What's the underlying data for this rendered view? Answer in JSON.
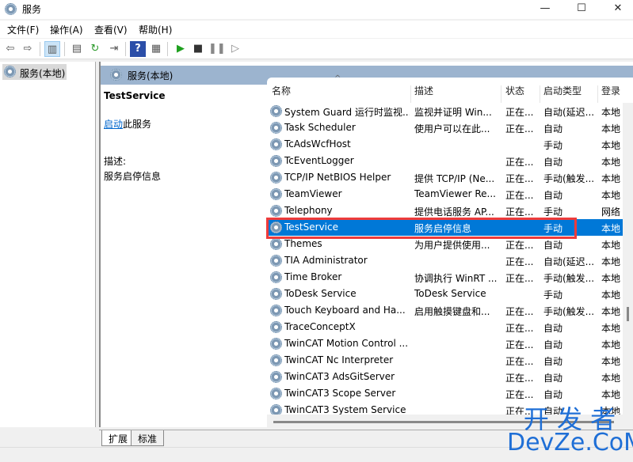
{
  "window": {
    "title": "服务",
    "min": "—",
    "max": "☐",
    "close": "✕"
  },
  "menu": [
    "文件(F)",
    "操作(A)",
    "查看(V)",
    "帮助(H)"
  ],
  "toolbar": [
    "back",
    "forward",
    "console-tree",
    "properties",
    "refresh",
    "export",
    "help",
    "action-pane",
    "start",
    "stop",
    "pause",
    "resume"
  ],
  "tree": {
    "item": "服务(本地)"
  },
  "band": {
    "title": "服务(本地)"
  },
  "details": {
    "name": "TestService",
    "link": "启动",
    "link_suffix": "此服务",
    "desc_label": "描述:",
    "desc": "服务启停信息"
  },
  "columns": [
    "名称",
    "描述",
    "状态",
    "启动类型",
    "登录"
  ],
  "rows": [
    [
      "System Guard 运行时监视...",
      "监视并证明 Win...",
      "正在...",
      "自动(延迟...",
      "本地"
    ],
    [
      "Task Scheduler",
      "使用户可以在此...",
      "正在...",
      "自动",
      "本地"
    ],
    [
      "TcAdsWcfHost",
      "",
      "",
      "手动",
      "本地"
    ],
    [
      "TcEventLogger",
      "",
      "正在...",
      "自动",
      "本地"
    ],
    [
      "TCP/IP NetBIOS Helper",
      "提供 TCP/IP (Ne...",
      "正在...",
      "手动(触发...",
      "本地"
    ],
    [
      "TeamViewer",
      "TeamViewer Re...",
      "正在...",
      "自动",
      "本地"
    ],
    [
      "Telephony",
      "提供电话服务 AP...",
      "正在...",
      "手动",
      "网络"
    ],
    [
      "TestService",
      "服务启停信息",
      "",
      "手动",
      "本地"
    ],
    [
      "Themes",
      "为用户提供使用...",
      "正在...",
      "自动",
      "本地"
    ],
    [
      "TIA Administrator",
      "",
      "正在...",
      "自动(延迟...",
      "本地"
    ],
    [
      "Time Broker",
      "协调执行 WinRT ...",
      "正在...",
      "手动(触发...",
      "本地"
    ],
    [
      "ToDesk Service",
      "ToDesk Service",
      "",
      "手动",
      "本地"
    ],
    [
      "Touch Keyboard and Ha...",
      "启用触摸键盘和...",
      "正在...",
      "手动(触发...",
      "本地"
    ],
    [
      "TraceConceptX",
      "",
      "正在...",
      "自动",
      "本地"
    ],
    [
      "TwinCAT Motion Control ...",
      "",
      "正在...",
      "自动",
      "本地"
    ],
    [
      "TwinCAT Nc Interpreter",
      "",
      "正在...",
      "自动",
      "本地"
    ],
    [
      "TwinCAT3 AdsGitServer",
      "",
      "正在...",
      "自动",
      "本地"
    ],
    [
      "TwinCAT3 Scope Server",
      "",
      "正在...",
      "自动",
      "本地"
    ],
    [
      "TwinCAT3 System Service",
      "",
      "正在...",
      "自动",
      "本地"
    ]
  ],
  "selected_row": 7,
  "tabs": [
    "扩展",
    "标准"
  ],
  "watermark": {
    "line1": "开 发 者",
    "line2": "DevZe.CoM"
  },
  "colors": {
    "selection": "#0078d7",
    "highlight_box": "#ee3b3b",
    "band": "#9cb4cf"
  }
}
